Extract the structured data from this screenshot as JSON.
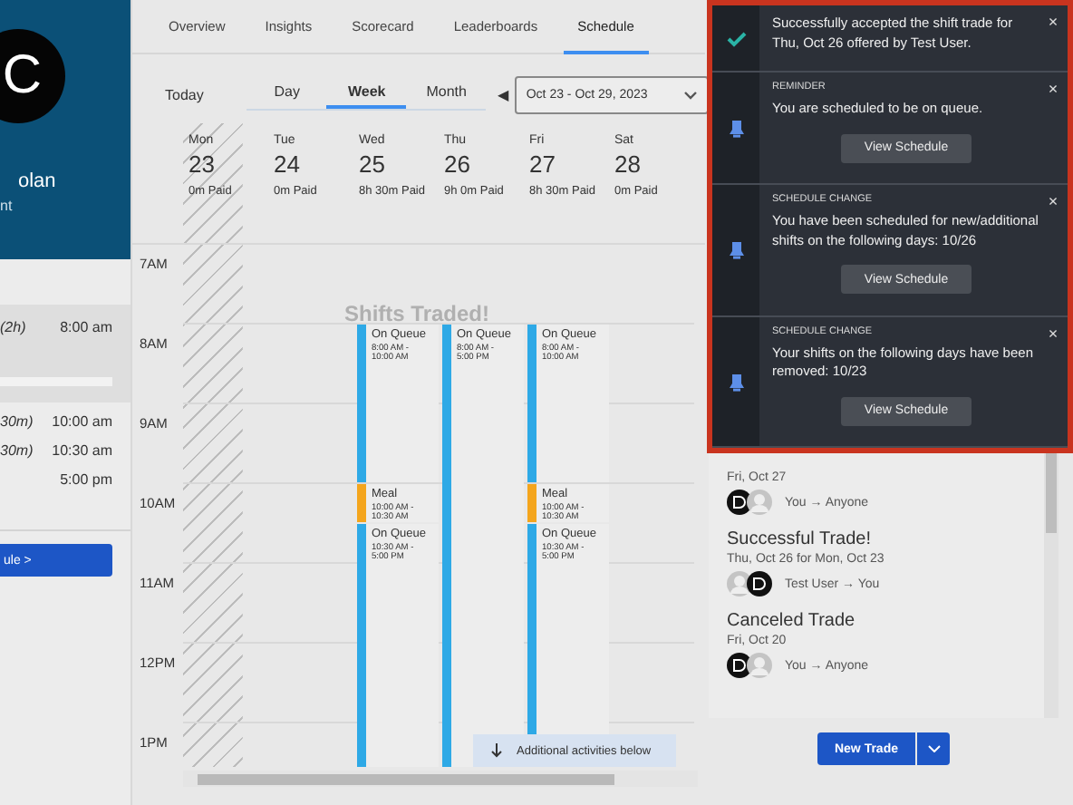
{
  "profile": {
    "initial": "C",
    "name": "olan",
    "role": "nt"
  },
  "agenda": [
    {
      "duration": "(2h)",
      "time": "8:00 am",
      "highlighted": true
    },
    {
      "duration": "30m)",
      "time": "10:00 am",
      "highlighted": false
    },
    {
      "duration": "30m)",
      "time": "10:30 am",
      "highlighted": false
    },
    {
      "time": "5:00 pm",
      "highlighted": false
    }
  ],
  "schedule_button": "ule >",
  "tabs": [
    {
      "label": "Overview",
      "selected": false
    },
    {
      "label": "Insights",
      "selected": false
    },
    {
      "label": "Scorecard",
      "selected": false
    },
    {
      "label": "Leaderboards",
      "selected": false
    },
    {
      "label": "Schedule",
      "selected": true
    }
  ],
  "today_button": "Today",
  "views": [
    {
      "label": "Day",
      "selected": false
    },
    {
      "label": "Week",
      "selected": true
    },
    {
      "label": "Month",
      "selected": false
    }
  ],
  "prev_arrow": "◀",
  "date_range": "Oct 23 - Oct 29, 2023",
  "days": [
    {
      "name": "Mon",
      "date": "23",
      "paid": "0m Paid",
      "unavailable": true
    },
    {
      "name": "Tue",
      "date": "24",
      "paid": "0m Paid",
      "unavailable": false
    },
    {
      "name": "Wed",
      "date": "25",
      "paid": "8h 30m Paid",
      "unavailable": false,
      "events": [
        {
          "kind": "queue",
          "title": "On Queue",
          "time": "8:00 AM - 10:00 AM"
        },
        {
          "kind": "meal",
          "title": "Meal",
          "time": "10:00 AM - 10:30 AM"
        },
        {
          "kind": "queue",
          "title": "On Queue",
          "time": "10:30 AM - 5:00 PM"
        }
      ]
    },
    {
      "name": "Thu",
      "date": "26",
      "paid": "9h 0m Paid",
      "unavailable": false,
      "events": [
        {
          "kind": "queue",
          "title": "On Queue",
          "time": "8:00 AM - 5:00 PM"
        }
      ]
    },
    {
      "name": "Fri",
      "date": "27",
      "paid": "8h 30m Paid",
      "unavailable": false,
      "events": [
        {
          "kind": "queue",
          "title": "On Queue",
          "time": "8:00 AM - 10:00 AM"
        },
        {
          "kind": "meal",
          "title": "Meal",
          "time": "10:00 AM - 10:30 AM"
        },
        {
          "kind": "queue",
          "title": "On Queue",
          "time": "10:30 AM - 5:00 PM"
        }
      ]
    },
    {
      "name": "Sat",
      "date": "28",
      "paid": "0m Paid",
      "unavailable": false
    }
  ],
  "hours": [
    "7AM",
    "8AM",
    "9AM",
    "10AM",
    "11AM",
    "12PM",
    "1PM"
  ],
  "ghost_toast": "Shifts Traded!",
  "more_below": "Additional activities below",
  "trades": [
    {
      "date": "Fri, Oct 27",
      "avatars": [
        {
          "kind": "logo"
        },
        {
          "kind": "person"
        }
      ],
      "route": "You → Anyone"
    },
    {
      "title": "Successful Trade!",
      "date": "Thu, Oct 26 for Mon, Oct 23",
      "avatars": [
        {
          "kind": "person"
        },
        {
          "kind": "logo"
        }
      ],
      "route": "Test User → You"
    },
    {
      "title": "Canceled Trade",
      "date": "Fri, Oct 20",
      "avatars": [
        {
          "kind": "logo"
        },
        {
          "kind": "person"
        }
      ],
      "route": "You → Anyone"
    }
  ],
  "new_trade": "New Trade",
  "notifications": [
    {
      "kind": "success",
      "message": "Successfully accepted the shift trade for Thu, Oct 26 offered by Test User.",
      "close": "×"
    },
    {
      "kind": "alert",
      "label": "REMINDER",
      "message": "You are scheduled to be on queue.",
      "button": "View Schedule",
      "close": "×"
    },
    {
      "kind": "alert",
      "label": "SCHEDULE CHANGE",
      "message": "You have been scheduled for new/additional shifts on the following days: 10/26",
      "button": "View Schedule",
      "close": "×"
    },
    {
      "kind": "alert",
      "label": "SCHEDULE CHANGE",
      "message": "Your shifts on the following days have been removed: 10/23",
      "button": "View Schedule",
      "close": "×"
    }
  ]
}
